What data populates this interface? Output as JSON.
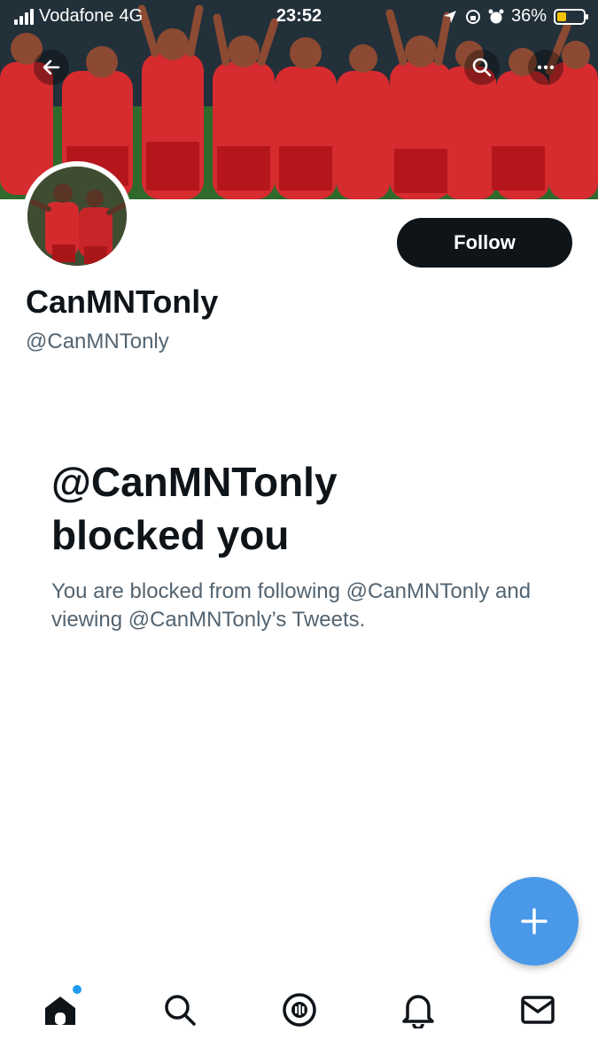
{
  "status_bar": {
    "carrier": "Vodafone",
    "network": "4G",
    "time": "23:52",
    "battery": "36%",
    "battery_level": 0.36,
    "battery_color": "#f5c400"
  },
  "header": {
    "back_icon": "back-arrow-icon",
    "search_icon": "search-icon",
    "more_icon": "more-options-icon"
  },
  "profile": {
    "display_name": "CanMNTonly",
    "handle": "@CanMNTonly",
    "follow_label": "Follow"
  },
  "blocked": {
    "title_line1": "@CanMNTonly",
    "title_line2": "blocked you",
    "message": "You are blocked from following @CanMNTonly and viewing @CanMNTonly’s Tweets."
  },
  "fab": {
    "icon": "plus-icon",
    "color": "#4a99e9"
  },
  "bottom_nav": {
    "items": [
      {
        "icon": "home-icon",
        "active": true,
        "has_badge": true
      },
      {
        "icon": "search-icon"
      },
      {
        "icon": "spaces-icon"
      },
      {
        "icon": "bell-icon"
      },
      {
        "icon": "mail-icon"
      }
    ]
  },
  "colors": {
    "primary_text": "#0f1419",
    "secondary_text": "#536471",
    "accent": "#1d9bf0"
  }
}
